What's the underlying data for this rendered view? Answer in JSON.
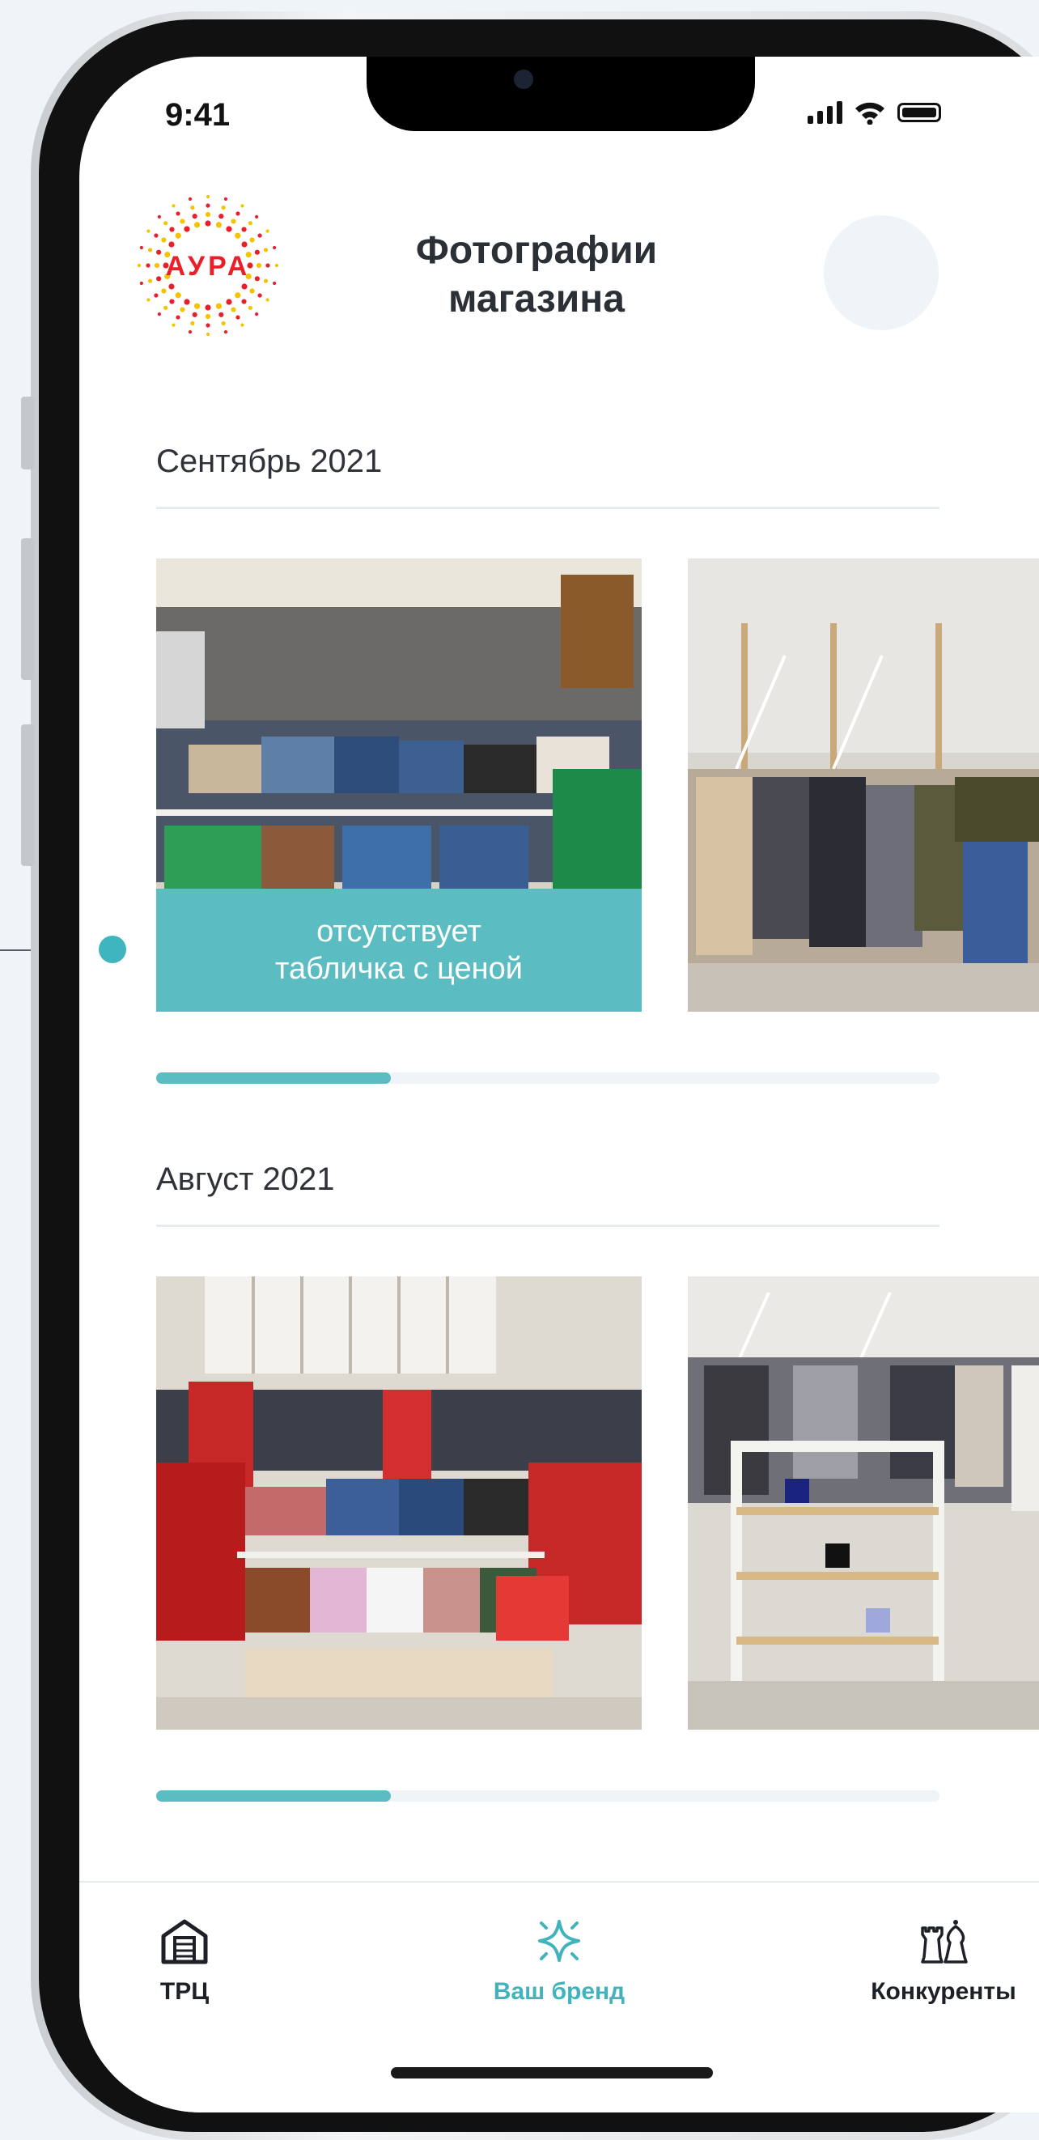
{
  "status_bar": {
    "time": "9:41"
  },
  "header": {
    "logo_text": "АУРА",
    "title_line1": "Фотографии",
    "title_line2": "магазина"
  },
  "sections": [
    {
      "title": "Сентябрь 2021",
      "photos": [
        {
          "label_line1": "отсутствует",
          "label_line2": "табличка с ценой"
        },
        {
          "label_line1": "",
          "label_line2": ""
        }
      ],
      "progress": 0.3
    },
    {
      "title": "Август 2021",
      "photos": [
        {
          "label_line1": "",
          "label_line2": ""
        },
        {
          "label_line1": "",
          "label_line2": ""
        }
      ],
      "progress": 0.3
    }
  ],
  "tabbar": {
    "items": [
      {
        "label": "ТРЦ",
        "icon": "mall-building-icon",
        "active": false
      },
      {
        "label": "Ваш бренд",
        "icon": "sparkle-star-icon",
        "active": true
      },
      {
        "label": "Конкуренты",
        "icon": "chess-pieces-icon",
        "active": false
      }
    ]
  },
  "colors": {
    "accent": "#5bbcc1",
    "active_tab": "#41b3bc",
    "text": "#2b2f36",
    "logo_red": "#e8202a",
    "logo_yellow": "#f5c400"
  }
}
